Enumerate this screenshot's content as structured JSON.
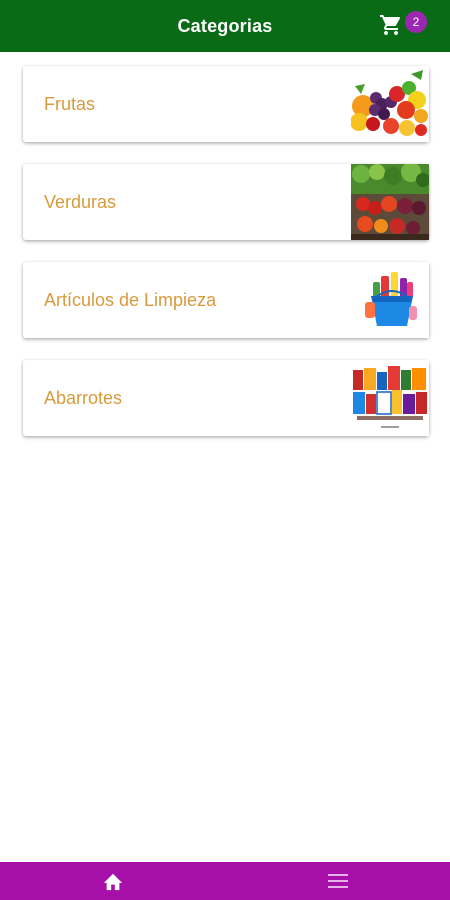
{
  "header": {
    "title": "Categorias",
    "cart_icon": "cart-icon",
    "cart_count": "2",
    "bg_color": "#0a6b16",
    "badge_color": "#9c27b0"
  },
  "categories": [
    {
      "label": "Frutas",
      "image": "fruits-image"
    },
    {
      "label": "Verduras",
      "image": "vegetables-image"
    },
    {
      "label": "Artículos de Limpieza",
      "image": "cleaning-products-image"
    },
    {
      "label": "Abarrotes",
      "image": "groceries-image"
    }
  ],
  "label_color": "#d89a3c",
  "bottom_nav": {
    "bg_color": "#a70fa9",
    "items": [
      {
        "icon": "home-icon"
      },
      {
        "icon": "menu-icon"
      }
    ]
  }
}
